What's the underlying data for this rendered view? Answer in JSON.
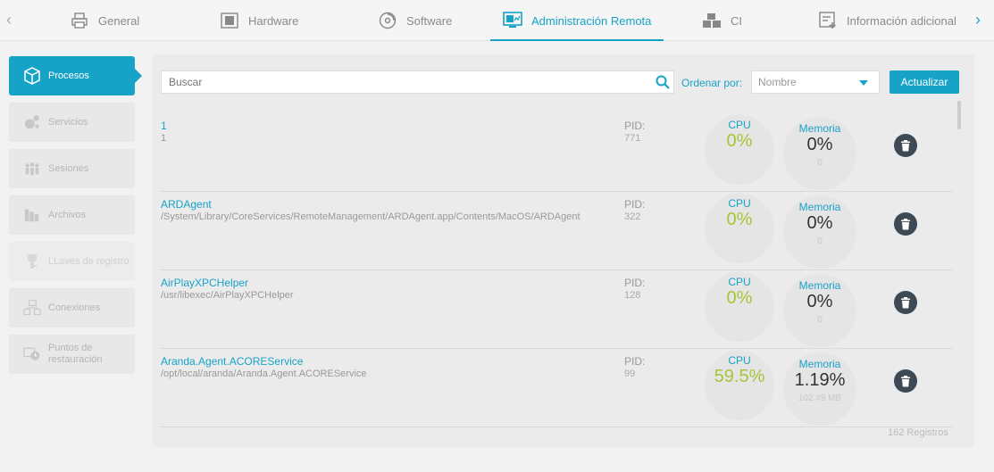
{
  "tabs": [
    {
      "label": "General",
      "icon": "printer-icon"
    },
    {
      "label": "Hardware",
      "icon": "chip-icon"
    },
    {
      "label": "Software",
      "icon": "disc-icon"
    },
    {
      "label": "Administración Remota",
      "icon": "monitor-icon",
      "active": true
    },
    {
      "label": "CI",
      "icon": "boxes-icon"
    },
    {
      "label": "Información adicional",
      "icon": "add-note-icon"
    }
  ],
  "sidebar": {
    "items": [
      {
        "label": "Procesos",
        "icon": "cube-icon",
        "active": true
      },
      {
        "label": "Servicios",
        "icon": "gears-icon"
      },
      {
        "label": "Sesiones",
        "icon": "users-icon"
      },
      {
        "label": "Archivos",
        "icon": "files-icon"
      },
      {
        "label": "LLaves de registro",
        "icon": "key-icon",
        "disabled": true
      },
      {
        "label": "Conexiones",
        "icon": "network-icon"
      },
      {
        "label": "Puntos de",
        "label2": "restauración",
        "icon": "restore-icon"
      }
    ]
  },
  "toolbar": {
    "search_placeholder": "Buscar",
    "order_label": "Ordenar por:",
    "order_value": "Nombre",
    "refresh_label": "Actualizar"
  },
  "columns": {
    "pid": "PID:",
    "cpu": "CPU",
    "memory": "Memoria"
  },
  "processes": [
    {
      "name": "1",
      "path": "1",
      "pid": "771",
      "cpu": "0%",
      "mem": "0%",
      "mem_size": "0"
    },
    {
      "name": "ARDAgent",
      "path": "/System/Library/CoreServices/RemoteManagement/ARDAgent.app/Contents/MacOS/ARDAgent",
      "pid": "322",
      "cpu": "0%",
      "mem": "0%",
      "mem_size": "0"
    },
    {
      "name": "AirPlayXPCHelper",
      "path": "/usr/libexec/AirPlayXPCHelper",
      "pid": "128",
      "cpu": "0%",
      "mem": "0%",
      "mem_size": "0"
    },
    {
      "name": "Aranda.Agent.ACOREService",
      "path": "/opt/local/aranda/Aranda.Agent.ACOREService",
      "pid": "99",
      "cpu": "59.5%",
      "mem": "1.19%",
      "mem_size": "102.49 MB"
    }
  ],
  "records_label": "162 Registros",
  "colors": {
    "accent": "#17a2c8",
    "cpu": "#a6c43a",
    "delete": "#3d4a56"
  }
}
